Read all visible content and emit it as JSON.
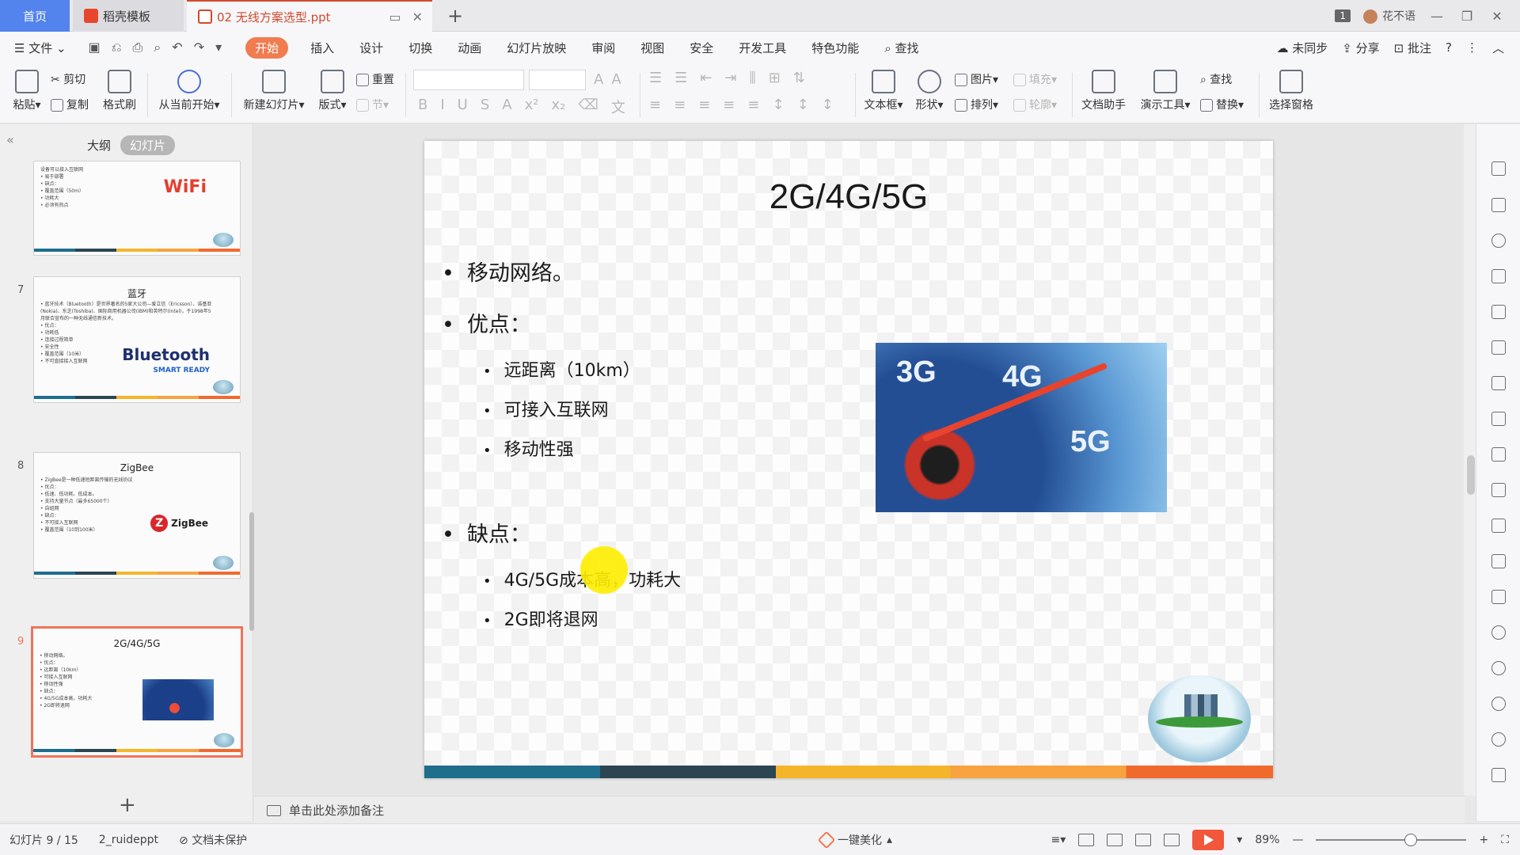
{
  "titlebar": {
    "home_tab": "首页",
    "template_tab": "稻壳模板",
    "file_tab": "02 无线方案选型.ppt",
    "new_tab": "+",
    "badge": "1",
    "user": "花不语"
  },
  "menu": {
    "file": "文件",
    "items": [
      "开始",
      "插入",
      "设计",
      "切换",
      "动画",
      "幻灯片放映",
      "审阅",
      "视图",
      "安全",
      "开发工具",
      "特色功能"
    ],
    "search": "查找",
    "sync": "未同步",
    "share": "分享",
    "comment": "批注"
  },
  "ribbon": {
    "paste": "粘贴",
    "cut": "剪切",
    "copy": "复制",
    "format_painter": "格式刷",
    "from_current": "从当前开始",
    "new_slide": "新建幻灯片",
    "layout": "版式",
    "reset": "重置",
    "section": "节",
    "textbox": "文本框",
    "shape": "形状",
    "picture": "图片",
    "fill": "填充",
    "arrange": "排列",
    "outline": "轮廓",
    "doc_helper": "文档助手",
    "present_tools": "演示工具",
    "find": "查找",
    "replace": "替换",
    "selection_pane": "选择窗格"
  },
  "panel": {
    "outline_tab": "大纲",
    "slides_tab": "幻灯片",
    "thumbs": [
      {
        "num": "",
        "title": "",
        "bullets": [
          "设备可以接入互联网",
          "• 易于部署",
          "• 缺点：",
          "• 覆盖范围（50m）",
          "• 功耗大",
          "• 必须有热点"
        ],
        "logo": "WiFi"
      },
      {
        "num": "7",
        "title": "蓝牙",
        "bullets": [
          "• 蓝牙技术（Bluetooth）是世界著名的5家大公司—爱立信（Ericsson）、诺基亚",
          "(Nokia)、东芝(Toshiba)、国际商用机器公司(IBM)和英特尔(Intel)，于1998年5",
          "月联合宣布的一种无线通信新技术。",
          "• 优点：",
          "• 功耗低",
          "• 连接过程简单",
          "• 安全性",
          "• 覆盖范围（10米）",
          "• 不可直接接入互联网"
        ],
        "logo": "Bluetooth",
        "logo_sub": "SMART READY"
      },
      {
        "num": "8",
        "title": "ZigBee",
        "bullets": [
          "• ZigBee是一种低速短距离传输的无线协议",
          "• 优点：",
          "• 低速、低功耗、低成本。",
          "• 支持大量节点（最多65000个）",
          "• 自组网",
          "",
          "• 缺点：",
          "• 不可接入互联网",
          "• 覆盖范围（10到100米）"
        ],
        "logo": "ZigBee"
      },
      {
        "num": "9",
        "title": "2G/4G/5G",
        "bullets": [
          "• 移动网络。",
          "• 优点：",
          "• 远距离（10km）",
          "• 可接入互联网",
          "• 移动性强",
          "",
          "• 缺点：",
          "• 4G/5G成本高，功耗大",
          "• 2G即将退网"
        ],
        "logo": ""
      }
    ],
    "add": "+"
  },
  "slide": {
    "title": "2G/4G/5G",
    "sections": [
      {
        "label": "移动网络。",
        "items": []
      },
      {
        "label": "优点：",
        "items": [
          "远距离（10km）",
          "可接入互联网",
          "移动性强"
        ]
      },
      {
        "label": "缺点：",
        "items": [
          "4G/5G成本高，功耗大",
          "2G即将退网"
        ]
      }
    ],
    "image_labels": [
      "3G",
      "4G",
      "5G"
    ]
  },
  "notes": "单击此处添加备注",
  "status": {
    "slide_count": "幻灯片 9 / 15",
    "theme": "2_ruideppt",
    "protect": "文档未保护",
    "beautify": "一键美化",
    "zoom": "89%"
  },
  "colors": {
    "accent": "#f07c50",
    "home_tab": "#5383ec",
    "active_thumb": "#f0735a"
  }
}
